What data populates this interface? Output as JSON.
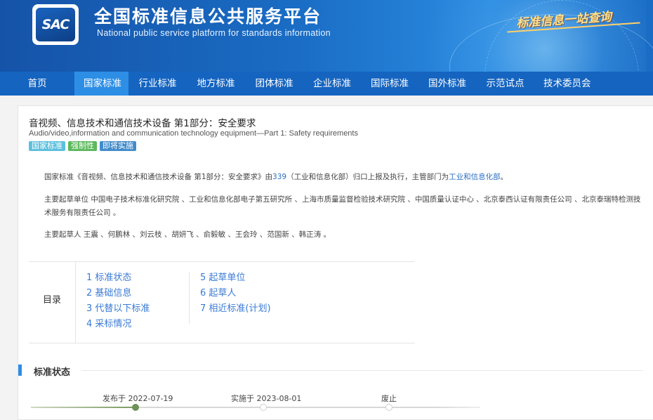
{
  "header": {
    "logo_text": "SAC",
    "title": "全国标准信息公共服务平台",
    "subtitle": "National public service platform  for standards information",
    "slogan": "标准信息一站查询"
  },
  "nav": [
    {
      "label": "首页",
      "active": false
    },
    {
      "label": "国家标准",
      "active": true
    },
    {
      "label": "行业标准",
      "active": false
    },
    {
      "label": "地方标准",
      "active": false
    },
    {
      "label": "团体标准",
      "active": false
    },
    {
      "label": "企业标准",
      "active": false
    },
    {
      "label": "国际标准",
      "active": false
    },
    {
      "label": "国外标准",
      "active": false
    },
    {
      "label": "示范试点",
      "active": false
    },
    {
      "label": "技术委员会",
      "active": false
    }
  ],
  "standard": {
    "title_cn": "音视频、信息技术和通信技术设备 第1部分：安全要求",
    "title_en": "Audio/video,information and communication technology equipment—Part 1: Safety requirements",
    "badges": [
      "国家标准",
      "强制性",
      "即将实施"
    ],
    "intro": {
      "prefix": "国家标准《音视频、信息技术和通信技术设备 第1部分：安全要求》由",
      "tc_code": "339",
      "tc_name": "（工业和信息化部）",
      "middle": "归口上报及执行，主管部门为",
      "dept": "工业和信息化部",
      "suffix": "。"
    },
    "drafting_units": "主要起草单位 中国电子技术标准化研究院 、工业和信息化部电子第五研究所 、上海市质量监督检验技术研究院 、中国质量认证中心 、北京泰西认证有限责任公司 、北京泰瑞特检测技术服务有限责任公司 。",
    "drafters": "主要起草人 王震 、何鹏林 、刘云枝 、胡妍飞 、俞毅敏 、王会玲 、范国新 、韩正涛 。"
  },
  "toc": {
    "label": "目录",
    "col1": [
      "1  标准状态",
      "2  基础信息",
      "3  代替以下标准",
      "4  采标情况"
    ],
    "col2": [
      "5  起草单位",
      "6  起草人",
      "7  相近标准(计划)"
    ]
  },
  "status_section": {
    "title": "标准状态",
    "timeline": [
      {
        "label": "发布于 2022-07-19",
        "done": true
      },
      {
        "label": "实施于 2023-08-01",
        "done": false
      },
      {
        "label": "废止",
        "done": false
      }
    ]
  },
  "colors": {
    "nav_bg": "#1564c0",
    "nav_active": "#2d8ee6",
    "link": "#2a6fc4",
    "badge_national": "#5bc0de",
    "badge_mandatory": "#5cb85c",
    "badge_upcoming": "#428bca",
    "timeline_done": "#6d9257"
  }
}
